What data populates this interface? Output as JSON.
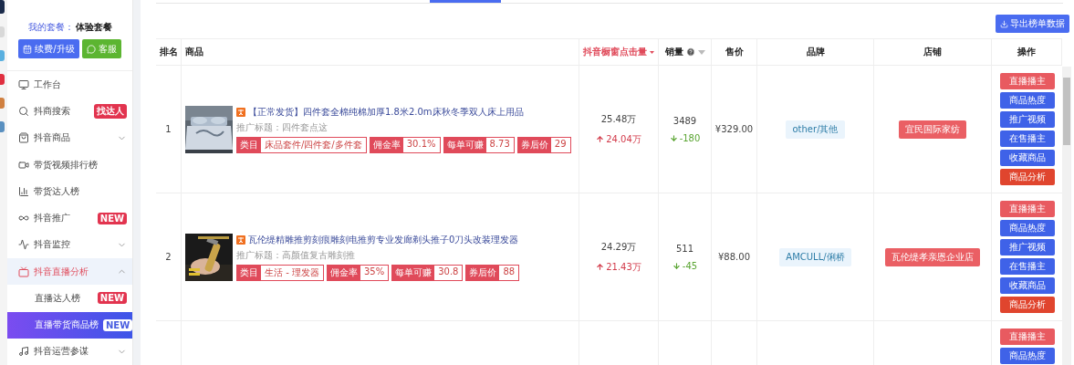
{
  "plan": {
    "label": "我的套餐：",
    "value": "体验套餐",
    "buttons": [
      {
        "label": "续费/升级"
      },
      {
        "label": "客服"
      }
    ]
  },
  "menu": [
    {
      "label": "工作台",
      "selected": false
    },
    {
      "label": "抖商搜索",
      "badge": "找达人",
      "selected": false
    },
    {
      "label": "抖音商品",
      "expanded": false,
      "selected": false
    },
    {
      "label": "带货视频排行榜",
      "selected": false
    },
    {
      "label": "带货达人榜",
      "selected": false
    },
    {
      "label": "抖音推广",
      "badge": "NEW",
      "selected": false
    },
    {
      "label": "抖音监控",
      "expanded": false,
      "selected": false
    },
    {
      "label": "抖音直播分析",
      "expanded": true,
      "selected": false,
      "children": [
        {
          "label": "直播达人榜",
          "badge": "NEW",
          "selected": false
        },
        {
          "label": "直播带货商品榜",
          "badge": "NEW",
          "selected": true
        }
      ]
    },
    {
      "label": "抖音运营参谋",
      "expanded": false,
      "selected": false
    }
  ],
  "export_button": "导出榜单数据",
  "table": {
    "columns": [
      {
        "label": "排名"
      },
      {
        "label": "商品"
      },
      {
        "label": "抖音橱窗点击量",
        "sorted": true
      },
      {
        "label": "销量",
        "help": true,
        "sorted": false
      },
      {
        "label": "售价"
      },
      {
        "label": "品牌"
      },
      {
        "label": "店铺"
      },
      {
        "label": "操作"
      }
    ],
    "rows": [
      {
        "rank": "1",
        "title": "【正常发货】四件套全棉纯棉加厚1.8米2.0m床秋冬季双人床上用品",
        "subtitle": "推广标题：四件套点这",
        "tags": [
          {
            "label": "类目",
            "value": "床品套件/四件套/多件套"
          },
          {
            "label": "佣金率",
            "value": "30.1%"
          },
          {
            "label": "每单可赚",
            "value": "8.73"
          },
          {
            "label": "券后价",
            "value": "29"
          }
        ],
        "clicks": "25.48万",
        "clicks_change": "24.04万",
        "clicks_up": true,
        "sales": "3489",
        "sales_change": "-180",
        "sales_up": false,
        "price": "¥329.00",
        "brand": "other/其他",
        "shop": "宜民国际家纺",
        "actions": [
          {
            "label": "直播播主",
            "kind": "light"
          },
          {
            "label": "商品热度",
            "kind": "primary"
          },
          {
            "label": "推广视频",
            "kind": "primary"
          },
          {
            "label": "在售播主",
            "kind": "primary"
          },
          {
            "label": "收藏商品",
            "kind": "primary"
          },
          {
            "label": "商品分析",
            "kind": "danger"
          }
        ]
      },
      {
        "rank": "2",
        "title": "瓦伦缇精雕推剪刻痕雕刻电推剪专业发廊剃头推子0刀头改装理发器",
        "subtitle": "推广标题：高颜值复古雕刻推",
        "tags": [
          {
            "label": "类目",
            "value": "生活 - 理发器"
          },
          {
            "label": "佣金率",
            "value": "35%"
          },
          {
            "label": "每单可赚",
            "value": "30.8"
          },
          {
            "label": "券后价",
            "value": "88"
          }
        ],
        "clicks": "24.29万",
        "clicks_change": "21.43万",
        "clicks_up": true,
        "sales": "511",
        "sales_change": "-45",
        "sales_up": false,
        "price": "¥88.00",
        "brand": "AMCULL/俐桥",
        "shop": "瓦伦缇孝亲恩企业店",
        "actions": [
          {
            "label": "直播播主",
            "kind": "light"
          },
          {
            "label": "商品热度",
            "kind": "primary"
          },
          {
            "label": "推广视频",
            "kind": "primary"
          },
          {
            "label": "在售播主",
            "kind": "primary"
          },
          {
            "label": "收藏商品",
            "kind": "primary"
          },
          {
            "label": "商品分析",
            "kind": "danger"
          }
        ]
      },
      {
        "actions": [
          {
            "label": "直播播主",
            "kind": "light"
          },
          {
            "label": "商品热度",
            "kind": "primary"
          }
        ]
      }
    ]
  }
}
